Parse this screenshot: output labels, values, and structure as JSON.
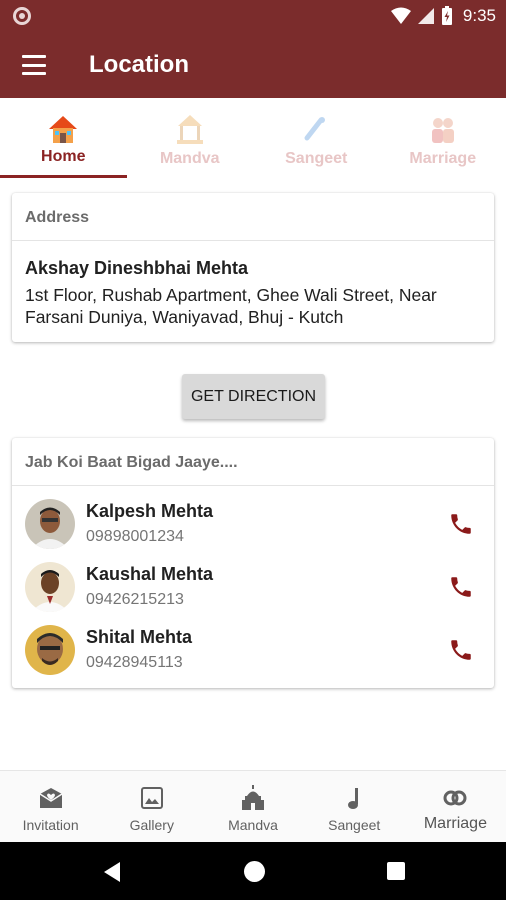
{
  "status_bar": {
    "time": "9:35"
  },
  "app_bar": {
    "title": "Location"
  },
  "tabs": [
    {
      "label": "Home",
      "icon": "house-icon",
      "active": true
    },
    {
      "label": "Mandva",
      "icon": "mandap-icon",
      "active": false
    },
    {
      "label": "Sangeet",
      "icon": "sangeet-icon",
      "active": false
    },
    {
      "label": "Marriage",
      "icon": "couple-icon",
      "active": false
    }
  ],
  "address": {
    "header": "Address",
    "name": "Akshay Dineshbhai Mehta",
    "text": "1st Floor, Rushab Apartment, Ghee Wali Street, Near Farsani Duniya, Waniyavad, Bhuj - Kutch"
  },
  "direction_button": {
    "label": "GET DIRECTION"
  },
  "contacts": {
    "header": "Jab Koi Baat Bigad Jaaye....",
    "items": [
      {
        "name": "Kalpesh Mehta",
        "phone": "09898001234"
      },
      {
        "name": "Kaushal Mehta",
        "phone": "09426215213"
      },
      {
        "name": "Shital Mehta",
        "phone": "09428945113"
      }
    ]
  },
  "bottom_nav": [
    {
      "label": "Invitation",
      "icon": "invitation-icon"
    },
    {
      "label": "Gallery",
      "icon": "gallery-icon"
    },
    {
      "label": "Mandva",
      "icon": "temple-icon"
    },
    {
      "label": "Sangeet",
      "icon": "music-note-icon"
    },
    {
      "label": "Marriage",
      "icon": "rings-icon",
      "selected": true
    }
  ],
  "colors": {
    "primary": "#7b2c2c",
    "accent": "#8b2323",
    "inactive_tab": "#e8c6c6"
  }
}
